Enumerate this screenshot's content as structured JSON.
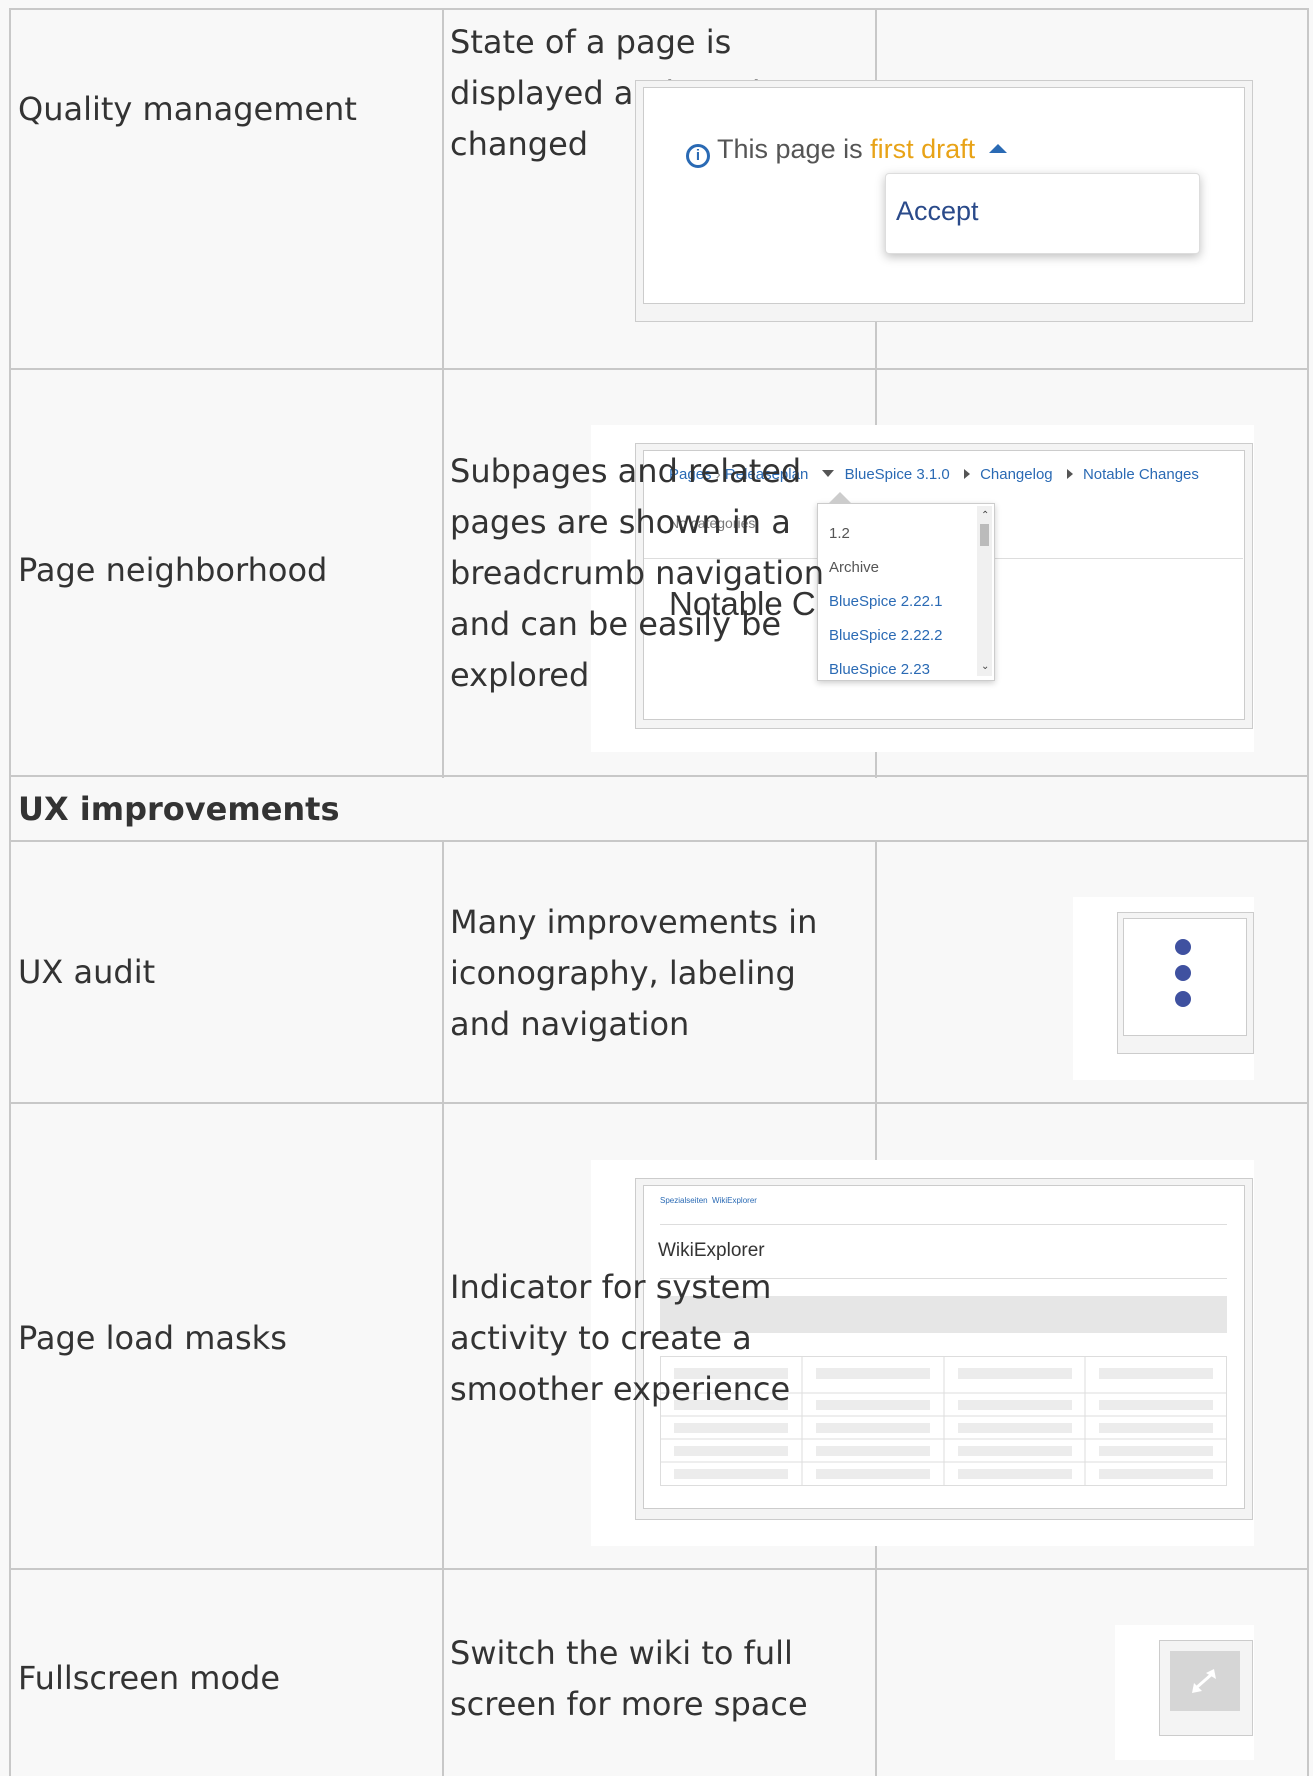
{
  "rows": [
    {
      "feature": "Quality management",
      "description_lines": [
        "State of a page is",
        "displayed and can be",
        "changed"
      ]
    },
    {
      "feature": "Page neighborhood",
      "description_lines": [
        "Subpages and related",
        "pages are shown in a",
        "breadcrumb navigation",
        "and can be easily be",
        "explored"
      ]
    }
  ],
  "section_heading": "UX improvements",
  "rows2": [
    {
      "feature": "UX audit",
      "description_lines": [
        "Many improvements in",
        "iconography, labeling",
        "and navigation"
      ]
    },
    {
      "feature": "Page load masks",
      "description_lines": [
        "Indicator for system",
        "activity to create a",
        "smoother experience"
      ]
    },
    {
      "feature": "Fullscreen mode",
      "description_lines": [
        "Switch the wiki to full",
        "screen for more space"
      ]
    }
  ],
  "qm_shot": {
    "prefix": "This page is",
    "state": "first draft",
    "menu_item": "Accept",
    "info_icon": "info-circle-icon",
    "accent": "#e8a317",
    "link": "#2a6ab4"
  },
  "nb_shot": {
    "crumbs": [
      "Pages",
      "Releaseplan",
      "BlueSpice 3.1.0",
      "Changelog",
      "Notable Changes"
    ],
    "categories": "No categories",
    "title": "Notable C",
    "dropdown": [
      "1.2",
      "Archive",
      "BlueSpice 2.22.1",
      "BlueSpice 2.22.2",
      "BlueSpice 2.23"
    ]
  },
  "ux_shot": {
    "icon": "more-vertical-icon",
    "dot_color": "#3f51a0"
  },
  "load_shot": {
    "crumbs": "Spezialseiten  WikiExplorer",
    "title": "WikiExplorer"
  },
  "fs_shot": {
    "icon": "expand-arrows-icon"
  }
}
